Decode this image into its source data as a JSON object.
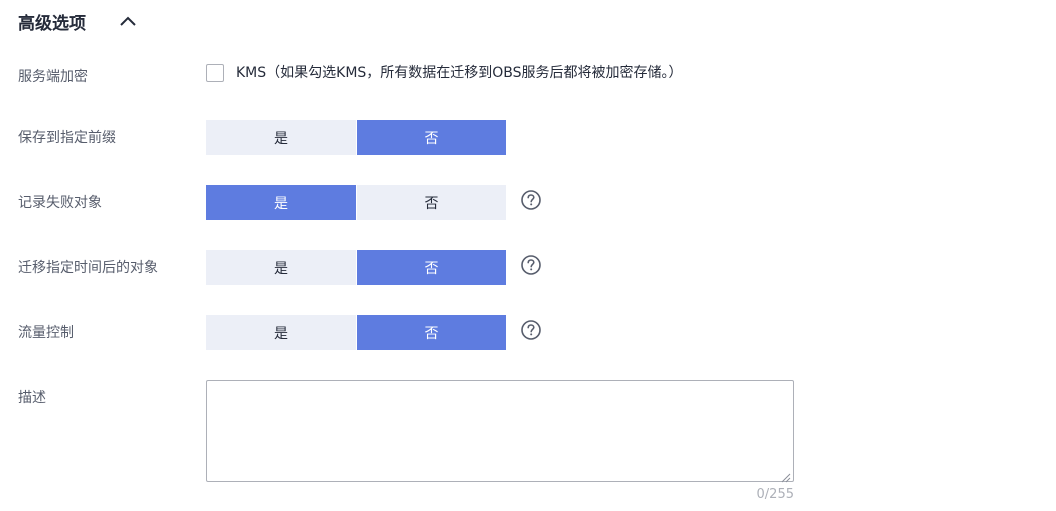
{
  "section": {
    "title": "高级选项",
    "toggle_icon": "chevron-up-icon"
  },
  "encryption": {
    "label": "服务端加密",
    "checkbox_checked": false,
    "checkbox_text": "KMS（如果勾选KMS，所有数据在迁移到OBS服务后都将被加密存储。）"
  },
  "save_prefix": {
    "label": "保存到指定前缀",
    "option_yes": "是",
    "option_no": "否",
    "selected": "否"
  },
  "record_failed": {
    "label": "记录失败对象",
    "option_yes": "是",
    "option_no": "否",
    "selected": "是",
    "help_icon": "question-circle-icon"
  },
  "migrate_after_time": {
    "label": "迁移指定时间后的对象",
    "option_yes": "是",
    "option_no": "否",
    "selected": "否",
    "help_icon": "question-circle-icon"
  },
  "traffic_control": {
    "label": "流量控制",
    "option_yes": "是",
    "option_no": "否",
    "selected": "否",
    "help_icon": "question-circle-icon"
  },
  "description": {
    "label": "描述",
    "value": "",
    "placeholder": "",
    "char_count": "0/255"
  },
  "colors": {
    "active": "#5e7ce0",
    "inactive": "#eceff7",
    "text": "#252b3a",
    "label": "#575d6c"
  }
}
